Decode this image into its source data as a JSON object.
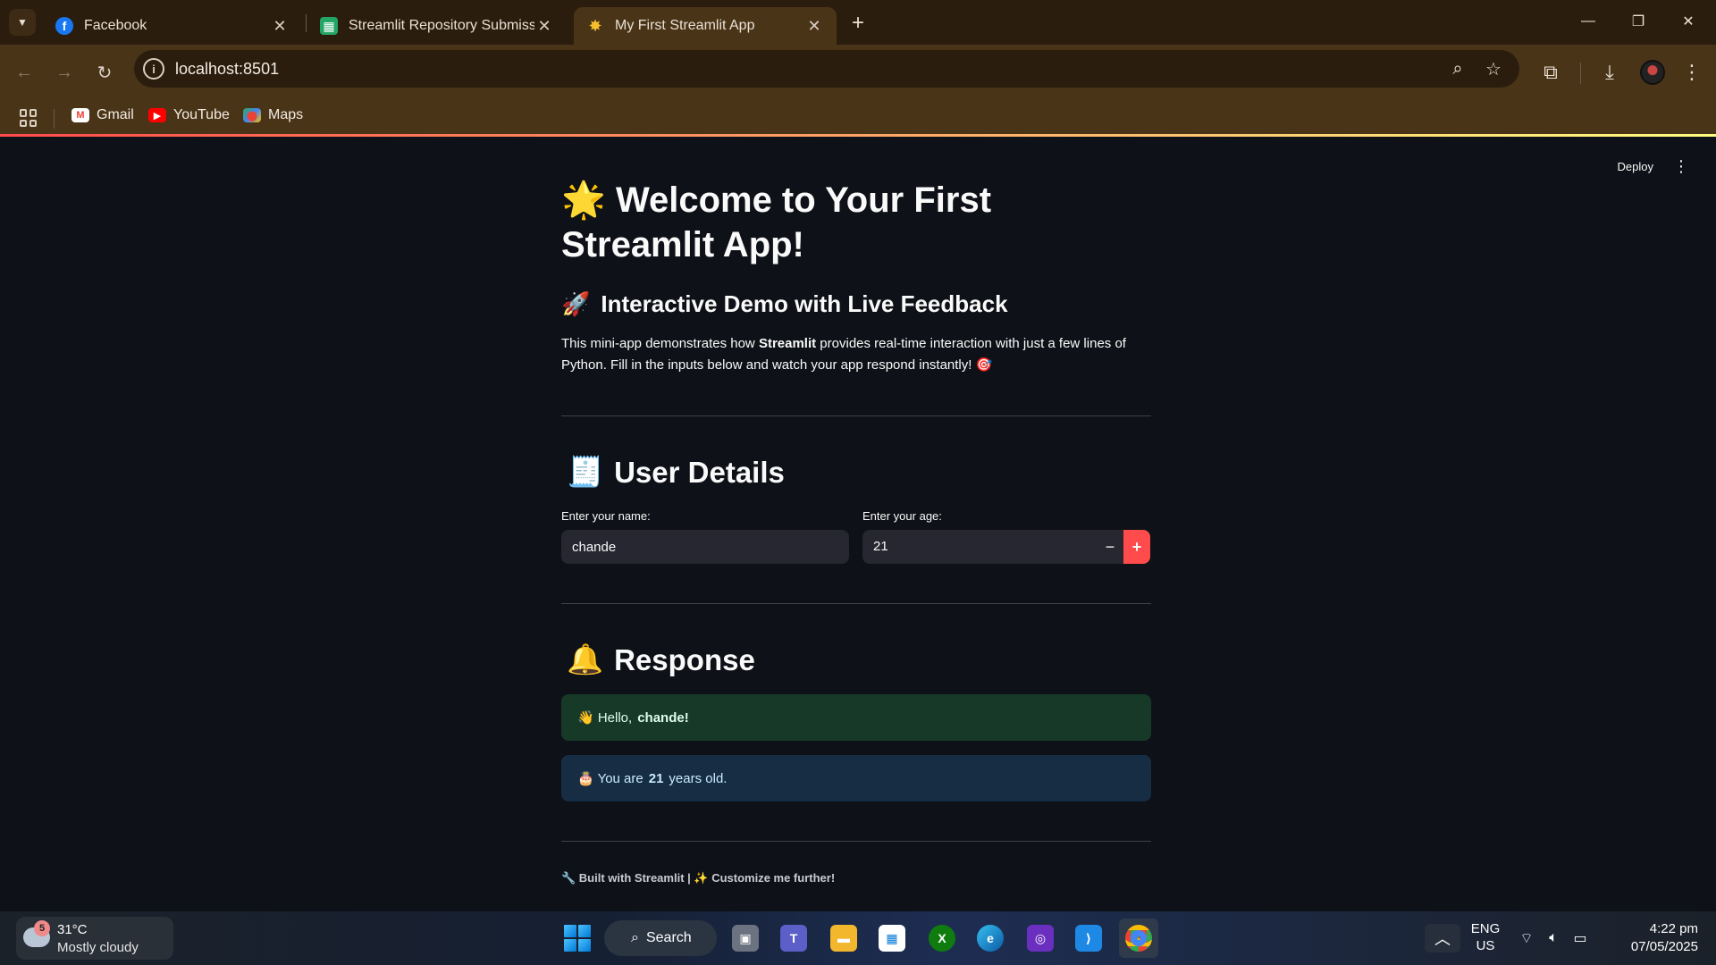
{
  "browser": {
    "tabs": [
      {
        "title": "Facebook",
        "active": false
      },
      {
        "title": "Streamlit Repository Submission",
        "active": false
      },
      {
        "title": "My First Streamlit App",
        "active": true
      }
    ],
    "url": "localhost:8501",
    "bookmarks": [
      {
        "label": "Gmail"
      },
      {
        "label": "YouTube"
      },
      {
        "label": "Maps"
      }
    ]
  },
  "app": {
    "header": {
      "deploy_label": "Deploy"
    },
    "title": "Welcome to Your First Streamlit App!",
    "title_emoji": "🌟",
    "subtitle": "Interactive Demo with Live Feedback",
    "subtitle_emoji": "🚀",
    "intro_before": "This mini-app demonstrates how ",
    "intro_bold": "Streamlit",
    "intro_after": " provides real-time interaction with just a few lines of Python. Fill in the inputs below and watch your app respond instantly! 🎯",
    "user_details": {
      "heading": "User Details",
      "emoji": "🧾",
      "name_label": "Enter your name:",
      "name_value": "chande",
      "age_label": "Enter your age:",
      "age_value": "21",
      "minus": "−",
      "plus": "+"
    },
    "response": {
      "heading": "Response",
      "emoji": "🔔",
      "hello_prefix": "👋 Hello, ",
      "hello_name": "chande!",
      "age_prefix": "🎂 You are ",
      "age_value": "21",
      "age_suffix": " years old."
    },
    "footer": {
      "part1": "🔧 Built with Streamlit | ✨ Customize me further!"
    }
  },
  "taskbar": {
    "weather": {
      "badge": "5",
      "temp": "31°C",
      "condition": "Mostly cloudy"
    },
    "search_label": "Search",
    "lang_line1": "ENG",
    "lang_line2": "US",
    "time": "4:22 pm",
    "date": "07/05/2025"
  },
  "colors": {
    "streamlit_red": "#ff4b4b",
    "background": "#0e1117",
    "success_bg": "#173928",
    "info_bg": "#172d43"
  }
}
